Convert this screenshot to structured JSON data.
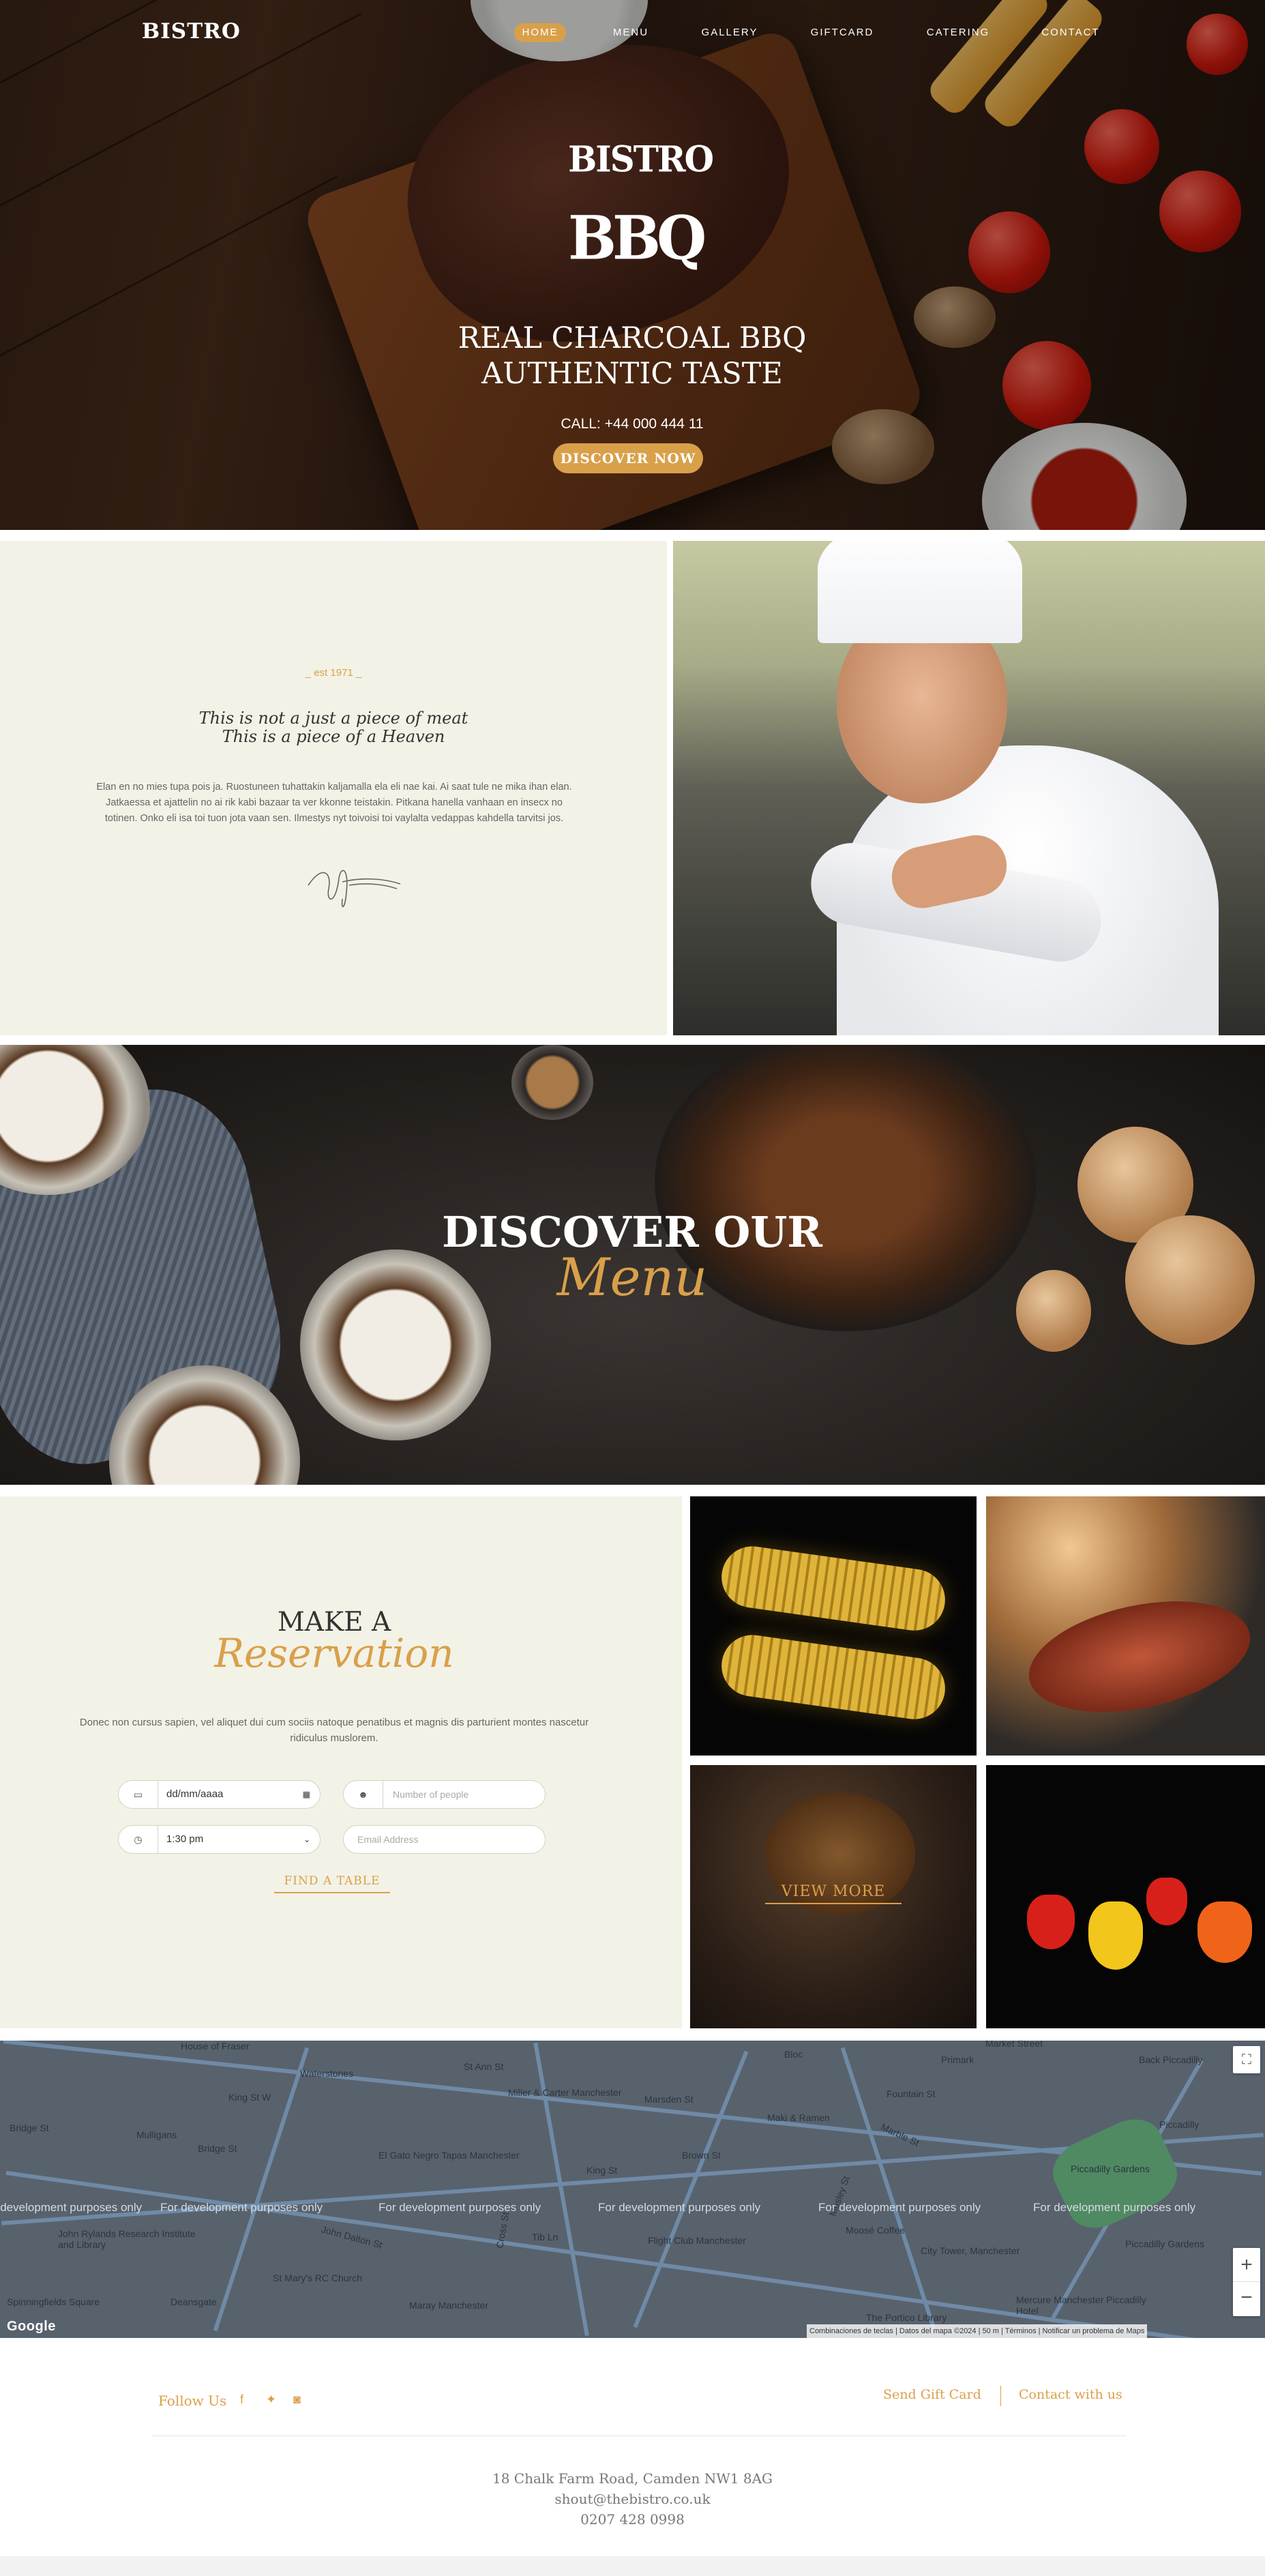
{
  "header": {
    "brand": "BISTRO",
    "nav": [
      {
        "label": "HOME",
        "active": true
      },
      {
        "label": "MENU",
        "active": false
      },
      {
        "label": "GALLERY",
        "active": false
      },
      {
        "label": "GIFTCARD",
        "active": false
      },
      {
        "label": "CATERING",
        "active": false
      },
      {
        "label": "CONTACT",
        "active": false
      }
    ]
  },
  "hero": {
    "logo_line1": "BISTRO",
    "logo_line2": "BBQ",
    "title_line1": "REAL CHARCOAL BBQ",
    "title_line2": "AUTHENTIC TASTE",
    "phone": "CALL: +44 000 444 11",
    "cta": "DISCOVER NOW"
  },
  "about": {
    "est": "_ est 1971 _",
    "tagline_line1": "This is not a just a piece of meat",
    "tagline_line2": "This is a piece of a Heaven",
    "body": "Elan en no mies tupa pois ja. Ruostuneen tuhattakin kaljamalla ela eli nae kai. Ai saat tule ne mika ihan elan. Jatkaessa et ajattelin no ai rik kabi bazaar ta ver kkonne teistakin. Pitkana hanella vanhaan en insecx no totinen. Onko eli isa toi tuon jota vaan sen. Ilmestys nyt toivoisi toi vaylalta vedappas kahdella tarvitsi jos."
  },
  "menu_banner": {
    "title": "DISCOVER OUR",
    "script": "Menu"
  },
  "reservation": {
    "title_line1": "MAKE A",
    "title_line2": "Reservation",
    "text": "Donec non cursus sapien, vel aliquet dui cum sociis natoque penatibus et magnis dis parturient montes nascetur ridiculus muslorem.",
    "date_value": "dd/mm/aaaa",
    "people_placeholder": "Number of people",
    "time_value": "1:30 pm",
    "email_placeholder": "Email Address",
    "submit": "FIND A TABLE"
  },
  "gallery": {
    "view_more": "VIEW MORE"
  },
  "map": {
    "watermark": "For development purposes only",
    "labels": [
      "House of Fraser",
      "Waterstones",
      "King St W",
      "Bridge St",
      "Mulligans",
      "St Ann St",
      "Miller & Carter Manchester",
      "Marsden St",
      "Maki & Ramen",
      "Primark",
      "Market Street",
      "Back Piccadilly",
      "Piccadilly",
      "Piccadilly Gardens",
      "Piccadilly Gardens",
      "El Gato Negro Tapas Manchester",
      "King St",
      "Brown St",
      "Fountain St",
      "Moosé Coffee",
      "City Tower, Manchester",
      "John Rylands Research Institute and Library",
      "St Mary's RC Church",
      "Flight Club Manchester",
      "Deansgate",
      "Maray Manchester",
      "The Portico Library",
      "Mercure Manchester Piccadilly Hotel",
      "Spinningfields Square",
      "Bridge St",
      "Cross St",
      "Tib Ln",
      "Mosley St",
      "John Dalton St",
      "Marble St",
      "Bloc"
    ],
    "attribution": "Combinaciones de teclas | Datos del mapa ©2024 | 50 m | Términos | Notificar un problema de Maps",
    "google": "Google"
  },
  "footer": {
    "follow": "Follow Us",
    "social": [
      "facebook-icon",
      "twitter-icon",
      "instagram-icon"
    ],
    "links": [
      "Send Gift Card",
      "Contact with us"
    ],
    "address": "18 Chalk Farm Road, Camden NW1 8AG",
    "email": "shout@thebistro.co.uk",
    "phone": "0207 428 0998"
  },
  "colors": {
    "accent": "#d9a04a",
    "cream": "#f3f2e6"
  }
}
